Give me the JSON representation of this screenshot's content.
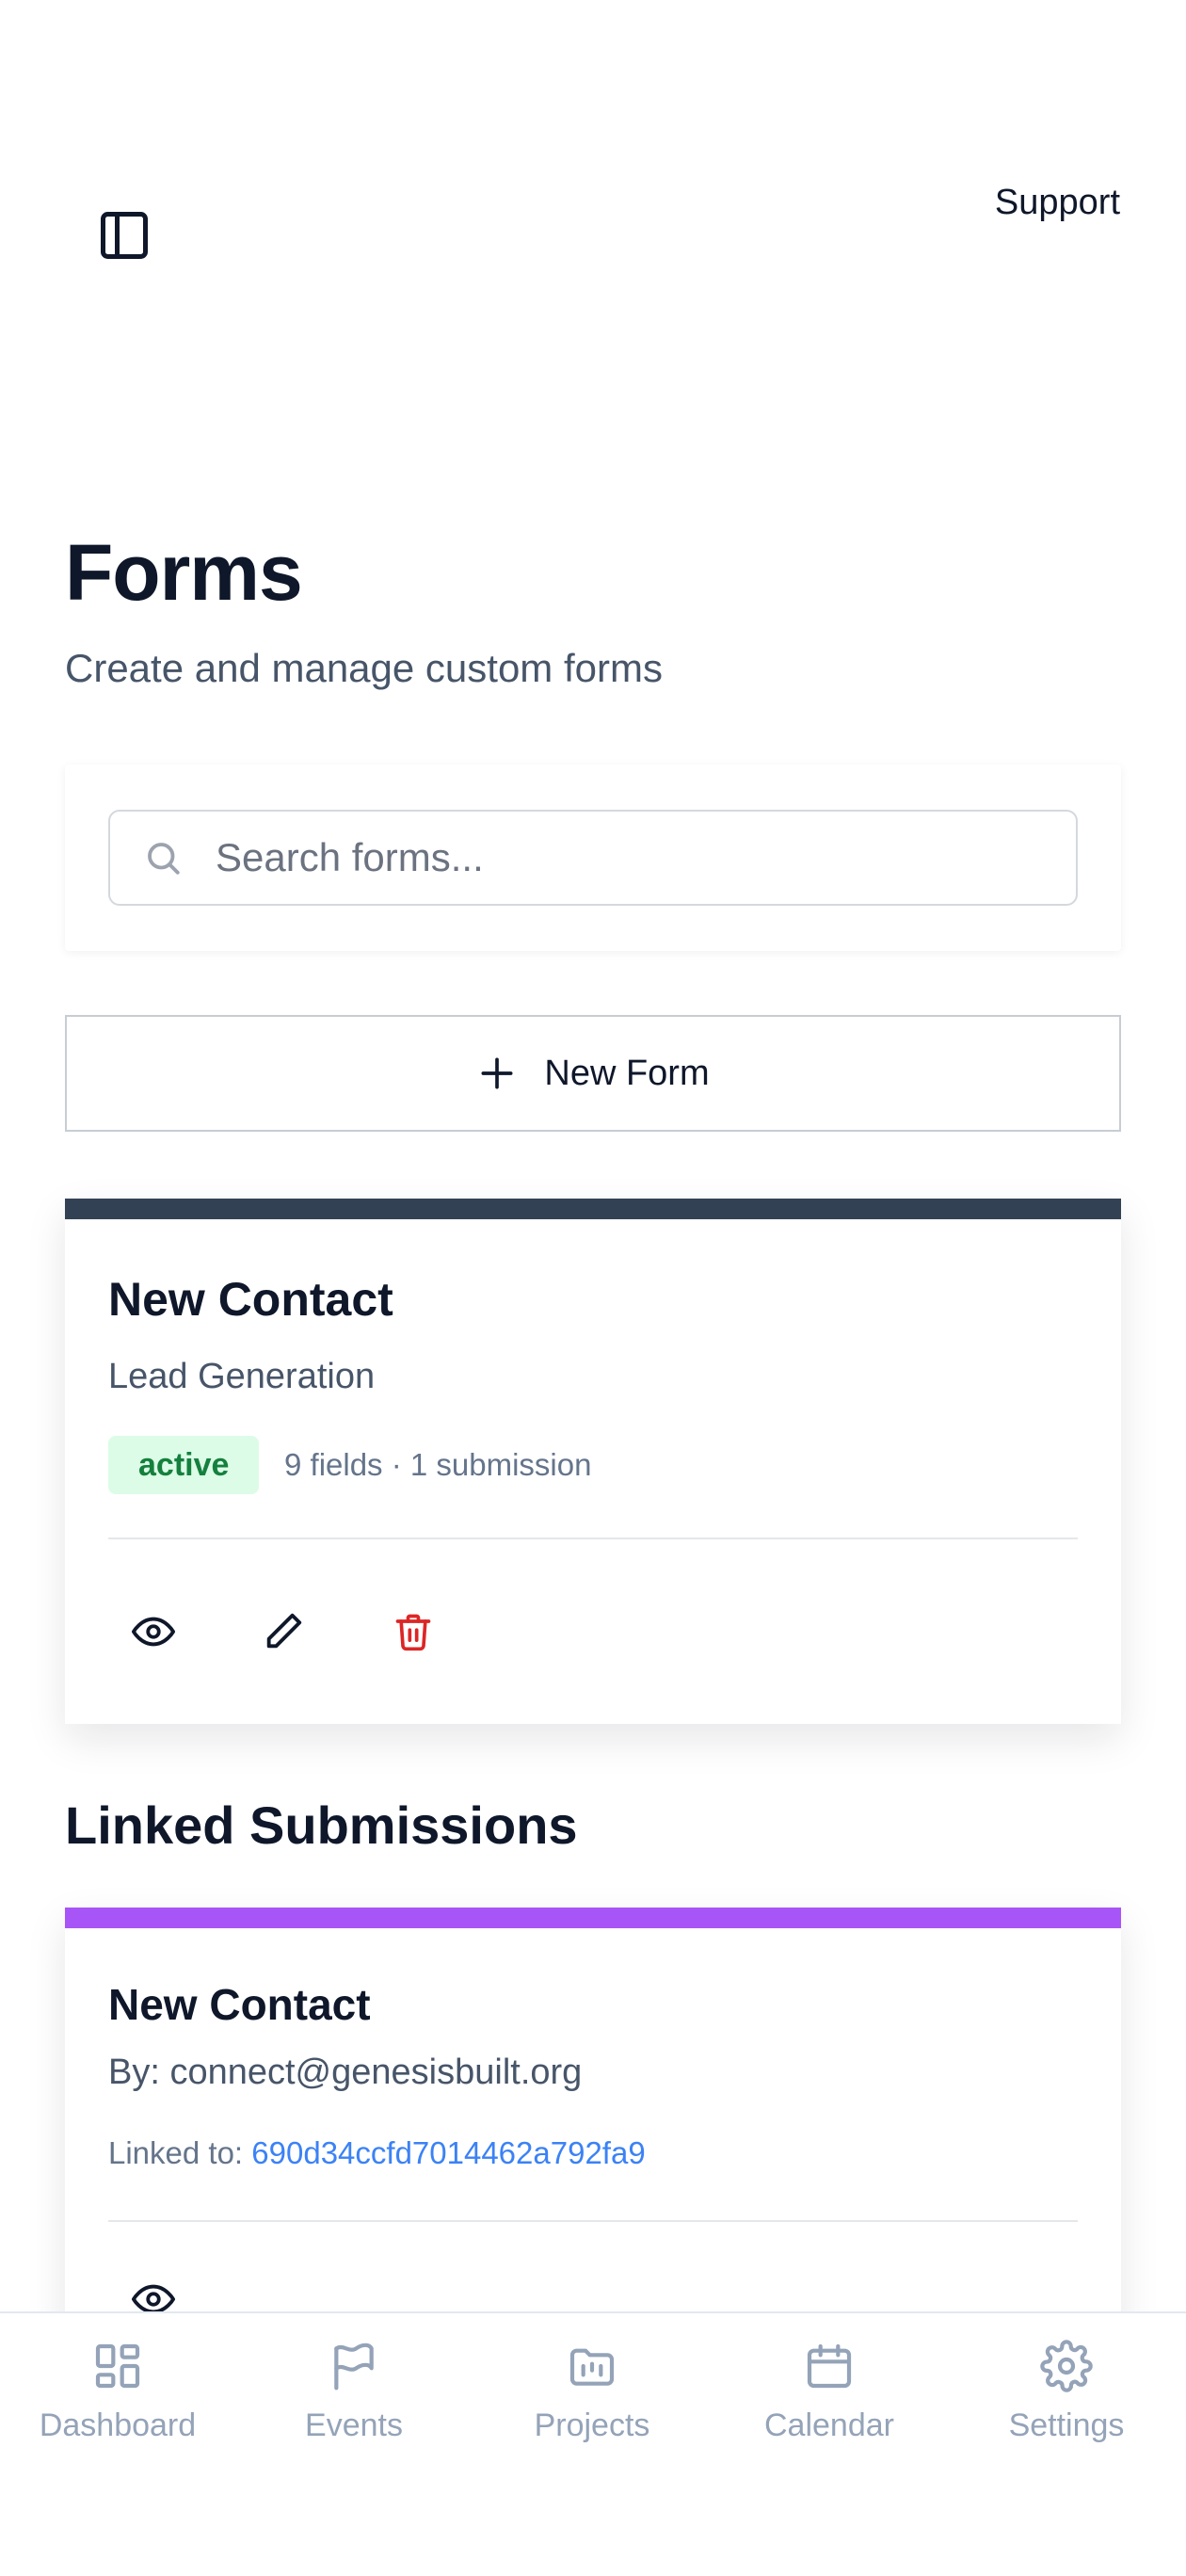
{
  "header": {
    "sidebar_toggle_icon": "sidebar-panel-icon",
    "support_label": "Support"
  },
  "page": {
    "title": "Forms",
    "subtitle": "Create and manage custom forms"
  },
  "search": {
    "placeholder": "Search forms...",
    "value": ""
  },
  "new_form": {
    "label": "New Form"
  },
  "forms": [
    {
      "title": "New Contact",
      "category": "Lead Generation",
      "status": "active",
      "meta": "9 fields · 1 submission",
      "stripe_color": "#334155"
    }
  ],
  "linked_submissions": {
    "title": "Linked Submissions",
    "items": [
      {
        "title": "New Contact",
        "by": "By: connect@genesisbuilt.org",
        "linked_label": "Linked to:",
        "linked_id": "690d34ccfd7014462a792fa9",
        "stripe_color": "#a855f7"
      }
    ]
  },
  "bottom_nav": {
    "items": [
      {
        "label": "Dashboard",
        "icon": "dashboard-icon"
      },
      {
        "label": "Events",
        "icon": "flag-icon"
      },
      {
        "label": "Projects",
        "icon": "folder-chart-icon"
      },
      {
        "label": "Calendar",
        "icon": "calendar-icon"
      },
      {
        "label": "Settings",
        "icon": "gear-icon"
      }
    ]
  },
  "colors": {
    "active_badge_bg": "#dcfce7",
    "active_badge_text": "#15803d",
    "link": "#3b82f6",
    "danger": "#dc2626",
    "nav_inactive": "#94a3b8"
  }
}
